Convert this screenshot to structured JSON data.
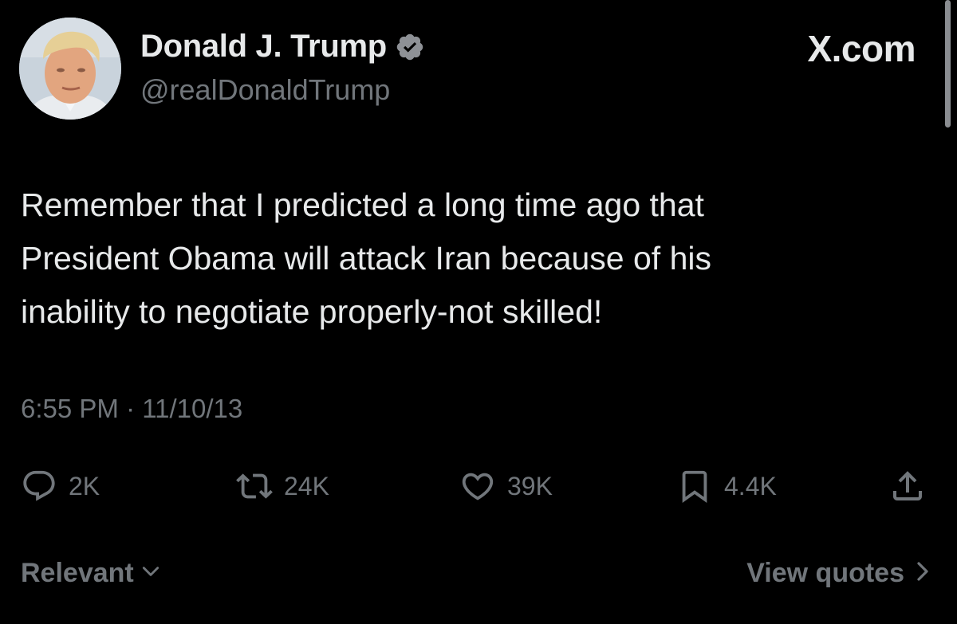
{
  "author": {
    "display_name": "Donald J. Trump",
    "handle": "@realDonaldTrump",
    "verified": true,
    "verified_color": "#1d9bf0",
    "avatar_icon": "profile-photo"
  },
  "site": {
    "logo_text": "X.com"
  },
  "tweet": {
    "text": "Remember that I predicted a long time ago that\nPresident Obama will attack Iran because of his\ninability to negotiate properly-not skilled!",
    "timestamp": "6:55 PM · 11/10/13"
  },
  "actions": {
    "reply": {
      "icon": "reply-icon",
      "count": "2K"
    },
    "retweet": {
      "icon": "retweet-icon",
      "count": "24K"
    },
    "like": {
      "icon": "heart-icon",
      "count": "39K"
    },
    "bookmark": {
      "icon": "bookmark-icon",
      "count": "4.4K"
    },
    "share": {
      "icon": "share-icon"
    }
  },
  "footer": {
    "sort_label": "Relevant",
    "view_quotes_label": "View quotes"
  },
  "colors": {
    "background": "#000000",
    "primary_text": "#e7e9ea",
    "secondary_text": "#71767b"
  }
}
